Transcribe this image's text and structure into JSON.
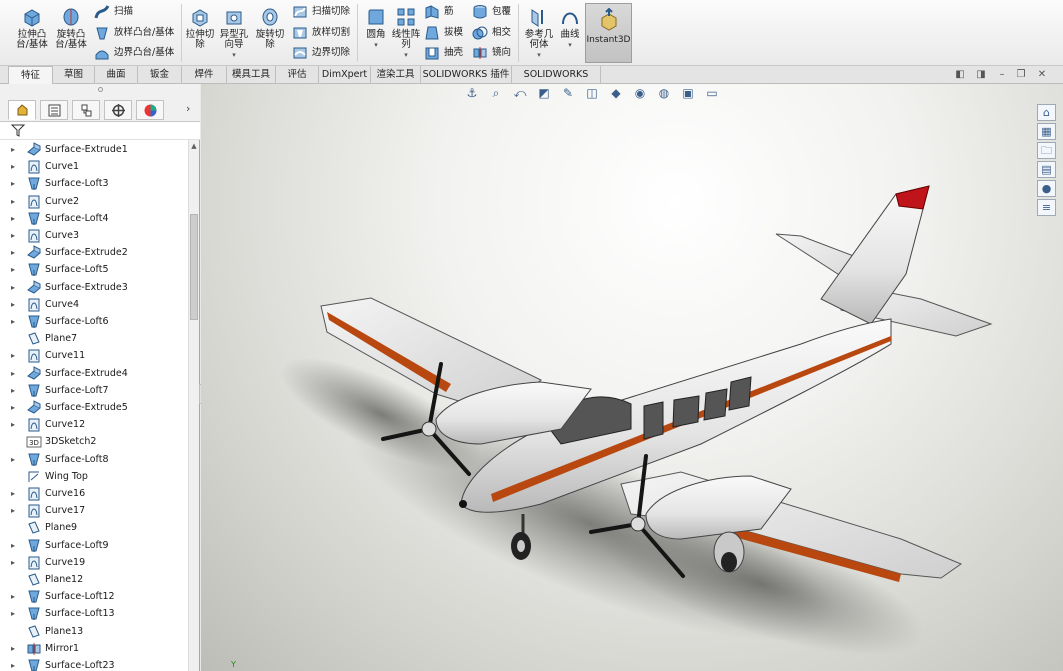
{
  "ribbon": {
    "features_big": [
      {
        "label": "拉伸凸\n台/基体",
        "icon": "extrude-boss-icon"
      },
      {
        "label": "旋转凸\n台/基体",
        "icon": "revolve-boss-icon"
      }
    ],
    "features_small": [
      {
        "label": "扫描",
        "icon": "sweep-icon"
      },
      {
        "label": "放样凸台/基体",
        "icon": "loft-boss-icon"
      },
      {
        "label": "边界凸台/基体",
        "icon": "boundary-boss-icon"
      }
    ],
    "cut_big": [
      {
        "label": "拉伸切\n除",
        "icon": "extrude-cut-icon"
      },
      {
        "label": "异型孔\n向导",
        "icon": "hole-wizard-icon"
      },
      {
        "label": "旋转切\n除",
        "icon": "revolve-cut-icon"
      }
    ],
    "cut_small": [
      {
        "label": "扫描切除",
        "icon": "swept-cut-icon"
      },
      {
        "label": "放样切割",
        "icon": "lofted-cut-icon"
      },
      {
        "label": "边界切除",
        "icon": "boundary-cut-icon"
      }
    ],
    "modify_big": [
      {
        "label": "圆角",
        "icon": "fillet-icon"
      },
      {
        "label": "线性阵\n列",
        "icon": "linear-pattern-icon"
      }
    ],
    "modify_small_col1": [
      {
        "label": "筋",
        "icon": "rib-icon"
      },
      {
        "label": "拔模",
        "icon": "draft-icon"
      },
      {
        "label": "抽壳",
        "icon": "shell-icon"
      }
    ],
    "modify_small_col2": [
      {
        "label": "包覆",
        "icon": "wrap-icon"
      },
      {
        "label": "相交",
        "icon": "intersect-icon"
      },
      {
        "label": "镜向",
        "icon": "mirror-icon"
      }
    ],
    "ref_big": [
      {
        "label": "参考几\n何体",
        "icon": "reference-geometry-icon"
      },
      {
        "label": "曲线",
        "icon": "curves-icon"
      }
    ],
    "instant3d": "Instant3D"
  },
  "tabs": [
    "特征",
    "草图",
    "曲面",
    "钣金",
    "焊件",
    "模具工具",
    "评估",
    "DimXpert",
    "渲染工具",
    "SOLIDWORKS 插件",
    "SOLIDWORKS MBD"
  ],
  "active_tab": "特征",
  "tree": [
    {
      "label": "Surface-Extrude1",
      "icon": "surface-extrude-icon",
      "expandable": true
    },
    {
      "label": "Curve1",
      "icon": "curve-icon",
      "expandable": true
    },
    {
      "label": "Surface-Loft3",
      "icon": "surface-loft-icon",
      "expandable": true
    },
    {
      "label": "Curve2",
      "icon": "curve-icon",
      "expandable": true
    },
    {
      "label": "Surface-Loft4",
      "icon": "surface-loft-icon",
      "expandable": true
    },
    {
      "label": "Curve3",
      "icon": "curve-icon",
      "expandable": true
    },
    {
      "label": "Surface-Extrude2",
      "icon": "surface-extrude-icon",
      "expandable": true
    },
    {
      "label": "Surface-Loft5",
      "icon": "surface-loft-icon",
      "expandable": true
    },
    {
      "label": "Surface-Extrude3",
      "icon": "surface-extrude-icon",
      "expandable": true
    },
    {
      "label": "Curve4",
      "icon": "curve-icon",
      "expandable": true
    },
    {
      "label": "Surface-Loft6",
      "icon": "surface-loft-icon",
      "expandable": true
    },
    {
      "label": "Plane7",
      "icon": "plane-icon",
      "expandable": false
    },
    {
      "label": "Curve11",
      "icon": "curve-icon",
      "expandable": true
    },
    {
      "label": "Surface-Extrude4",
      "icon": "surface-extrude-icon",
      "expandable": true
    },
    {
      "label": "Surface-Loft7",
      "icon": "surface-loft-icon",
      "expandable": true
    },
    {
      "label": "Surface-Extrude5",
      "icon": "surface-extrude-icon",
      "expandable": true
    },
    {
      "label": "Curve12",
      "icon": "curve-icon",
      "expandable": true
    },
    {
      "label": "3DSketch2",
      "icon": "3d-sketch-icon",
      "expandable": false
    },
    {
      "label": "Surface-Loft8",
      "icon": "surface-loft-icon",
      "expandable": true
    },
    {
      "label": "Wing Top",
      "icon": "sketch-icon",
      "expandable": false
    },
    {
      "label": "Curve16",
      "icon": "curve-icon",
      "expandable": true
    },
    {
      "label": "Curve17",
      "icon": "curve-icon",
      "expandable": true
    },
    {
      "label": "Plane9",
      "icon": "plane-icon",
      "expandable": false
    },
    {
      "label": "Surface-Loft9",
      "icon": "surface-loft-icon",
      "expandable": true
    },
    {
      "label": "Curve19",
      "icon": "curve-icon",
      "expandable": true
    },
    {
      "label": "Plane12",
      "icon": "plane-icon",
      "expandable": false
    },
    {
      "label": "Surface-Loft12",
      "icon": "surface-loft-icon",
      "expandable": true
    },
    {
      "label": "Surface-Loft13",
      "icon": "surface-loft-icon",
      "expandable": true
    },
    {
      "label": "Plane13",
      "icon": "plane-icon",
      "expandable": false
    },
    {
      "label": "Mirror1",
      "icon": "mirror-icon",
      "expandable": true
    },
    {
      "label": "Surface-Loft23",
      "icon": "surface-loft-icon",
      "expandable": true
    }
  ],
  "left_tabs": [
    "feature-manager-icon",
    "property-manager-icon",
    "configuration-manager-icon",
    "dimxpert-manager-icon",
    "display-manager-icon"
  ],
  "hud_icons": [
    "zoom-to-fit-icon",
    "zoom-to-area-icon",
    "previous-view-icon",
    "section-view-icon",
    "dynamic-annotation-icon",
    "view-orientation-icon",
    "display-style-icon",
    "hide-show-items-icon",
    "edit-appearance-icon",
    "apply-scene-icon",
    "view-settings-icon"
  ],
  "task_pane_icons": [
    "home-icon",
    "design-library-icon",
    "file-explorer-icon",
    "view-palette-icon",
    "appearances-icon",
    "custom-properties-icon"
  ],
  "colors": {
    "accent_orange": "#b8480f",
    "tail_red": "#c0141b",
    "fuselage": "#e9e9e9",
    "edge_blue": "#4a90c8"
  }
}
